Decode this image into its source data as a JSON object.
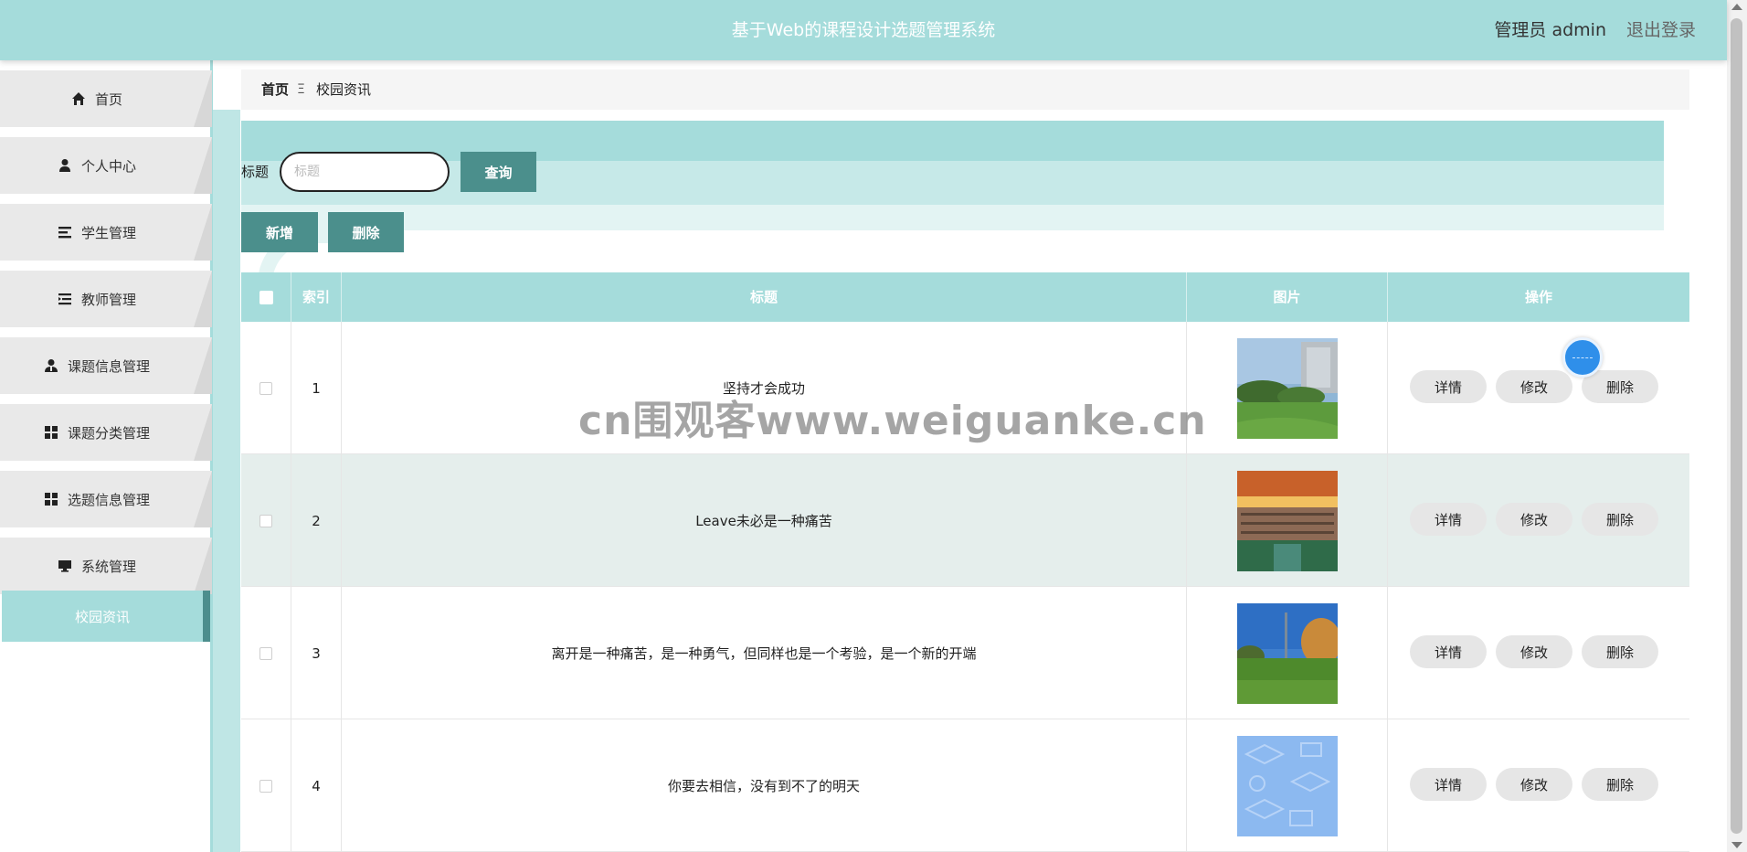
{
  "header": {
    "title": "基于Web的课程设计选题管理系统",
    "user": "管理员 admin",
    "logout": "退出登录"
  },
  "sidebar": {
    "items": [
      {
        "label": "首页",
        "icon": "home-icon"
      },
      {
        "label": "个人中心",
        "icon": "user-icon"
      },
      {
        "label": "学生管理",
        "icon": "list-icon"
      },
      {
        "label": "教师管理",
        "icon": "indent-list-icon"
      },
      {
        "label": "课题信息管理",
        "icon": "user-tie-icon"
      },
      {
        "label": "课题分类管理",
        "icon": "grid-icon"
      },
      {
        "label": "选题信息管理",
        "icon": "grid-icon"
      },
      {
        "label": "系统管理",
        "icon": "monitor-icon"
      }
    ],
    "active": "校园资讯"
  },
  "breadcrumb": {
    "home": "首页",
    "separator": "Ξ",
    "current": "校园资讯"
  },
  "search": {
    "label": "标题",
    "placeholder": "标题",
    "value": "",
    "query_button": "查询"
  },
  "actions": {
    "add": "新增",
    "delete": "删除"
  },
  "table": {
    "headers": {
      "index": "索引",
      "title": "标题",
      "image": "图片",
      "ops": "操作"
    },
    "rows": [
      {
        "index": "1",
        "title": "坚持才会成功",
        "image": "campus-lawn-photo"
      },
      {
        "index": "2",
        "title": "Leave未必是一种痛苦",
        "image": "campus-sunset-photo"
      },
      {
        "index": "3",
        "title": "离开是一种痛苦，是一种勇气，但同样也是一个考验，是一个新的开端",
        "image": "campus-field-photo"
      },
      {
        "index": "4",
        "title": "你要去相信，没有到不了的明天",
        "image": "school-pattern-image"
      }
    ],
    "row_buttons": {
      "detail": "详情",
      "edit": "修改",
      "delete": "删除"
    }
  },
  "watermark": "cn围观客www.weiguanke.cn",
  "colors": {
    "header": "#a5dcdb",
    "button": "#4b8f8c",
    "active_bar": "#4c8e8d"
  }
}
